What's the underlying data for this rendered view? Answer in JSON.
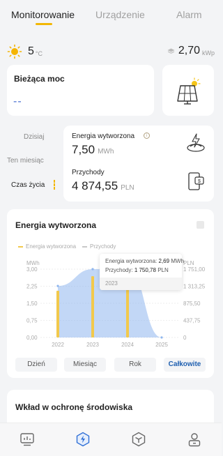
{
  "tabs": [
    "Monitorowanie",
    "Urządzenie",
    "Alarm"
  ],
  "weather": {
    "temperature": "5",
    "unit": "°C",
    "icon": "sun-icon"
  },
  "capacity": {
    "value": "2,70",
    "unit": "kWp"
  },
  "current_power": {
    "title": "Bieżąca moc",
    "value": "--"
  },
  "periods": [
    "Dzisiaj",
    "Ten miesiąc",
    "Czas życia"
  ],
  "stats": {
    "energy_label": "Energia wytworzona",
    "energy_value": "7,50",
    "energy_unit": "MWh",
    "income_label": "Przychody",
    "income_value": "4 874,55",
    "income_unit": "PLN"
  },
  "chart": {
    "title": "Energia wytworzona",
    "legend_energy": "Energia wytworzona",
    "legend_income": "Przychody",
    "left_unit": "MWh",
    "right_unit": "PLN",
    "colors": {
      "energy": "#f2c94c",
      "income": "#8fb6ee",
      "accent": "#f2b705"
    },
    "tooltip": {
      "energy_label": "Energia wytworzona:",
      "energy_value": "2,69",
      "energy_unit": "MWh",
      "income_label": "Przychody:",
      "income_value": "1 750,78",
      "income_unit": "PLN",
      "year": "2023"
    }
  },
  "chart_data": {
    "type": "bar",
    "categories": [
      "2022",
      "2023",
      "2024",
      "2025"
    ],
    "series": [
      {
        "name": "Energia wytworzona",
        "values": [
          2.05,
          2.69,
          2.76,
          0
        ]
      },
      {
        "name": "Przychody",
        "values": [
          1320,
          1750.78,
          1790,
          0
        ]
      }
    ],
    "ylim": [
      0,
      3
    ],
    "y2lim": [
      0,
      1751
    ],
    "yticks": [
      "0,00",
      "0,75",
      "1,50",
      "2,25",
      "3,00"
    ],
    "y2ticks": [
      "0",
      "437,75",
      "875,50",
      "1 313,25",
      "1 751,00"
    ],
    "ylabel": "MWh",
    "y2label": "PLN",
    "grid": true,
    "legend": "top-left"
  },
  "range_buttons": [
    "Dzień",
    "Miesiąc",
    "Rok",
    "Całkowite"
  ],
  "environment": {
    "title": "Wkład w ochronę środowiska"
  },
  "nav": [
    "chart-nav-icon",
    "lightning-nav-icon",
    "device-nav-icon",
    "user-nav-icon"
  ]
}
